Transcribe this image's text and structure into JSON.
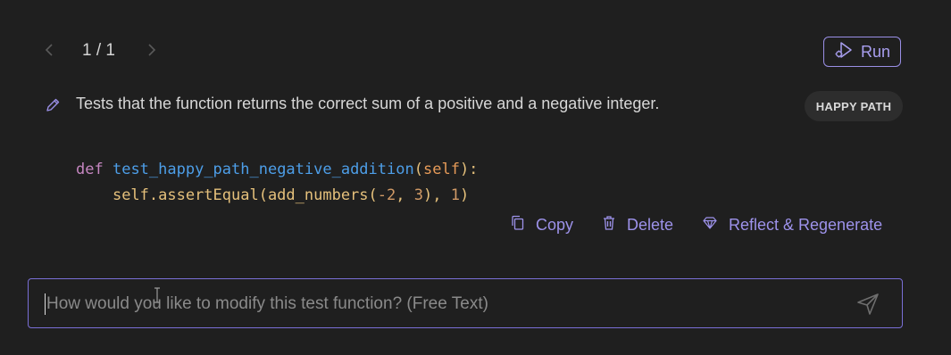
{
  "pager": {
    "text": "1 / 1"
  },
  "run": {
    "label": "Run"
  },
  "test": {
    "description": "Tests that the function returns the correct sum of a positive and a negative integer.",
    "badge": "HAPPY PATH",
    "code": {
      "line1": {
        "kw": "def",
        "fn": "test_happy_path_negative_addition",
        "open": "(",
        "param": "self",
        "close": "):"
      },
      "line2": {
        "pre": "self.assertEqual(add_numbers(",
        "a": "-2",
        "sep": ", ",
        "b": "3",
        "mid": "), ",
        "c": "1",
        "post": ")"
      }
    }
  },
  "actions": {
    "copy": "Copy",
    "delete": "Delete",
    "reflect": "Reflect & Regenerate"
  },
  "modify": {
    "placeholder": "How would you like to modify this test function? (Free Text)"
  },
  "colors": {
    "accent": "#9d92ea",
    "background": "#1f1f1f"
  }
}
